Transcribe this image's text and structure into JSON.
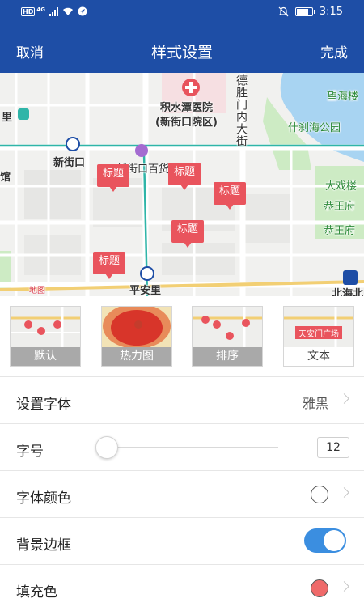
{
  "status_bar": {
    "hd": "HD",
    "network": "4G",
    "time": "3:15"
  },
  "nav": {
    "cancel": "取消",
    "title": "样式设置",
    "done": "完成"
  },
  "map": {
    "labels": {
      "hospital": "积水潭医院",
      "hospital_branch": "(新街口院区)",
      "road_desheng": "德胜门内大街",
      "wanghai": "望海楼",
      "shichahai": "什刹海公园",
      "xinjiekou": "新街口",
      "baihuo": "新街口百货",
      "daxilou": "大戏楼",
      "gongwangfu": "恭王府",
      "gongwangfu2": "恭王府",
      "li": "里",
      "guan": "馆",
      "pinganli": "平安里",
      "beihai": "北海北",
      "baidu": "地图"
    },
    "marker_text": "标题"
  },
  "style_options": [
    {
      "label": "默认",
      "selected": false
    },
    {
      "label": "热力图",
      "selected": false
    },
    {
      "label": "排序",
      "selected": false
    },
    {
      "label": "文本",
      "selected": true,
      "thumb_text": "天安门广场"
    }
  ],
  "settings": {
    "font": {
      "label": "设置字体",
      "value": "雅黑"
    },
    "font_size": {
      "label": "字号",
      "value": "12"
    },
    "font_color": {
      "label": "字体颜色",
      "color": "#ffffff"
    },
    "bg_border": {
      "label": "背景边框",
      "enabled": true
    },
    "fill_color": {
      "label": "填充色",
      "color": "#ef6a6a"
    }
  },
  "colors": {
    "primary": "#1e4ea6",
    "marker": "#e9545d",
    "toggle_on": "#3b8ee0"
  }
}
